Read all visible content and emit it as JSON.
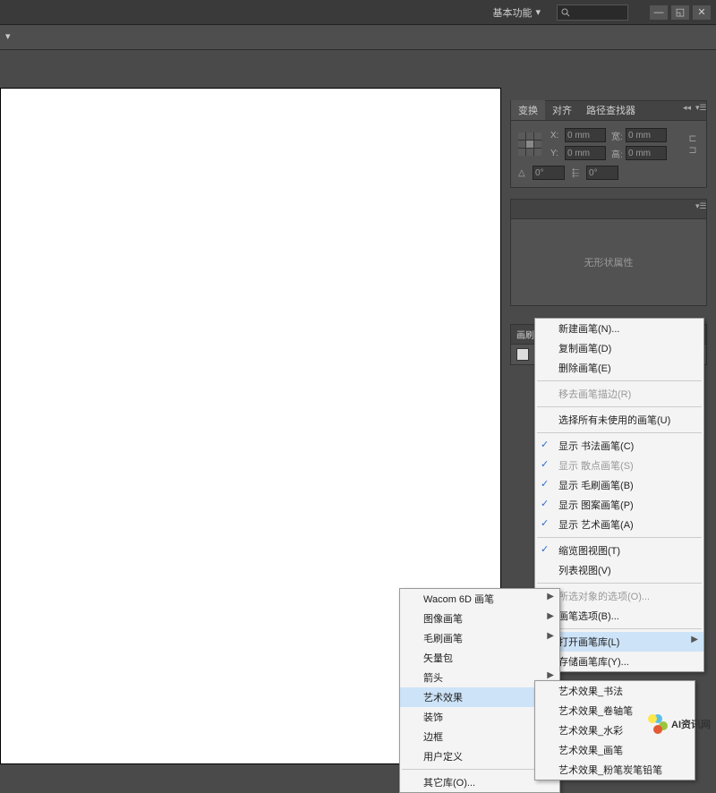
{
  "topbar": {
    "workspace_label": "基本功能",
    "search_placeholder": ""
  },
  "panels": {
    "transform": {
      "tabs": [
        "变换",
        "对齐",
        "路径查找器"
      ],
      "x_label": "X:",
      "x_value": "0 mm",
      "w_label": "宽:",
      "w_value": "0 mm",
      "y_label": "Y:",
      "y_value": "0 mm",
      "h_label": "高:",
      "h_value": "0 mm",
      "angle_label": "△",
      "angle_value": "0°",
      "shear_label": "⬱",
      "shear_value": "0°"
    },
    "appearance": {
      "empty_text": "无形状属性"
    },
    "brush": {
      "header": "画刷动作所需品"
    }
  },
  "menu_main": {
    "new_brush": "新建画笔(N)...",
    "duplicate": "复制画笔(D)",
    "delete": "删除画笔(E)",
    "remove_stroke": "移去画笔描边(R)",
    "select_unused": "选择所有未使用的画笔(U)",
    "show_calligraphic": "显示 书法画笔(C)",
    "show_scatter": "显示 散点画笔(S)",
    "show_bristle": "显示 毛刷画笔(B)",
    "show_pattern": "显示 图案画笔(P)",
    "show_art": "显示 艺术画笔(A)",
    "thumbnail_view": "缩览图视图(T)",
    "list_view": "列表视图(V)",
    "options_of_selected": "所选对象的选项(O)...",
    "brush_options": "画笔选项(B)...",
    "open_library": "打开画笔库(L)",
    "save_library": "存储画笔库(Y)..."
  },
  "menu_library": {
    "wacom": "Wacom 6D 画笔",
    "image": "图像画笔",
    "bristle": "毛刷画笔",
    "vector": "矢量包",
    "arrows": "箭头",
    "artistic": "艺术效果",
    "decorative": "装饰",
    "borders": "边框",
    "user": "用户定义",
    "other": "其它库(O)..."
  },
  "menu_artistic": {
    "calligraphy": "艺术效果_书法",
    "scroll_pen": "艺术效果_卷轴笔",
    "watercolor": "艺术效果_水彩",
    "ink": "艺术效果_画笔",
    "chalk": "艺术效果_粉笔炭笔铅笔"
  },
  "watermark": "AI资讯网"
}
